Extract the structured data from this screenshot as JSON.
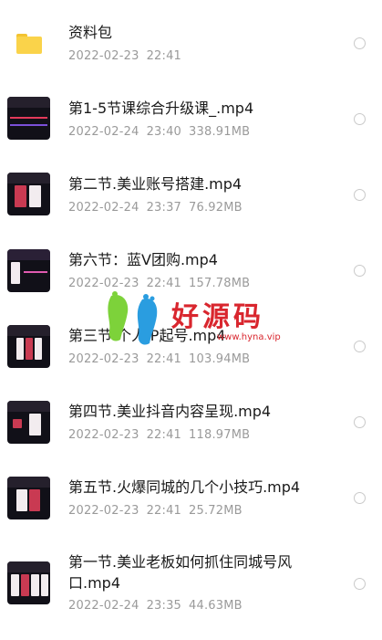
{
  "files": [
    {
      "name": "资料包",
      "date": "2022-02-23",
      "time": "22:41",
      "size": "",
      "kind": "folder-icon"
    },
    {
      "name": "第1-5节课综合升级课_.mp4",
      "date": "2022-02-24",
      "time": "23:40",
      "size": "338.91MB",
      "kind": "video-thumbnail"
    },
    {
      "name": "第二节.美业账号搭建.mp4",
      "date": "2022-02-24",
      "time": "23:37",
      "size": "76.92MB",
      "kind": "video-thumbnail"
    },
    {
      "name": "第六节：蓝V团购.mp4",
      "date": "2022-02-23",
      "time": "22:41",
      "size": "157.78MB",
      "kind": "video-thumbnail"
    },
    {
      "name": "第三节.个人IP起号.mp4",
      "date": "2022-02-23",
      "time": "22:41",
      "size": "103.94MB",
      "kind": "video-thumbnail"
    },
    {
      "name": "第四节.美业抖音内容呈现.mp4",
      "date": "2022-02-23",
      "time": "22:41",
      "size": "118.97MB",
      "kind": "video-thumbnail"
    },
    {
      "name": "第五节.火爆同城的几个小技巧.mp4",
      "date": "2022-02-23",
      "time": "22:41",
      "size": "25.72MB",
      "kind": "video-thumbnail"
    },
    {
      "name": "第一节.美业老板如何抓住同城号风口.mp4",
      "date": "2022-02-24",
      "time": "23:35",
      "size": "44.63MB",
      "kind": "video-thumbnail"
    }
  ],
  "watermark": {
    "text": "好源码",
    "url": "www.hyna.vip"
  },
  "colors": {
    "accent": "#d9262e",
    "meta": "#9a9a9a",
    "folder": "#fad34a"
  }
}
